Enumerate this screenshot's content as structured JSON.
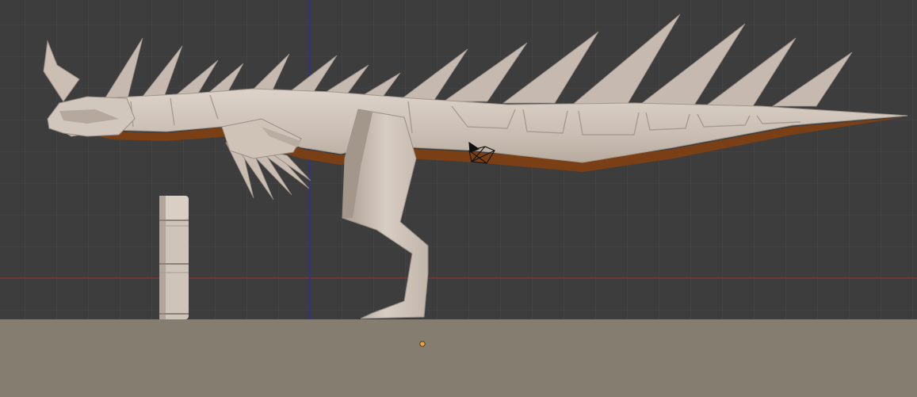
{
  "viewport": {
    "mode": "3d-viewport",
    "shading": "solid",
    "colors": {
      "background": "#3d3d3d",
      "grid_line": "#474747",
      "x_axis": "#8a3434",
      "z_axis": "#2b2bb8",
      "ground": "#857d6f",
      "model_base": "#c8bdb2",
      "model_light": "#ddd3ca",
      "model_shadow": "#9a8f86",
      "model_underside": "#7a3f14",
      "origin_marker": "#f0a040"
    }
  },
  "objects": [
    {
      "name": "dinosaur",
      "icon": "mesh-icon"
    },
    {
      "name": "reference-pillar",
      "icon": "mesh-icon"
    },
    {
      "name": "camera",
      "icon": "camera-icon"
    },
    {
      "name": "ground-plane",
      "icon": "plane-icon"
    }
  ]
}
